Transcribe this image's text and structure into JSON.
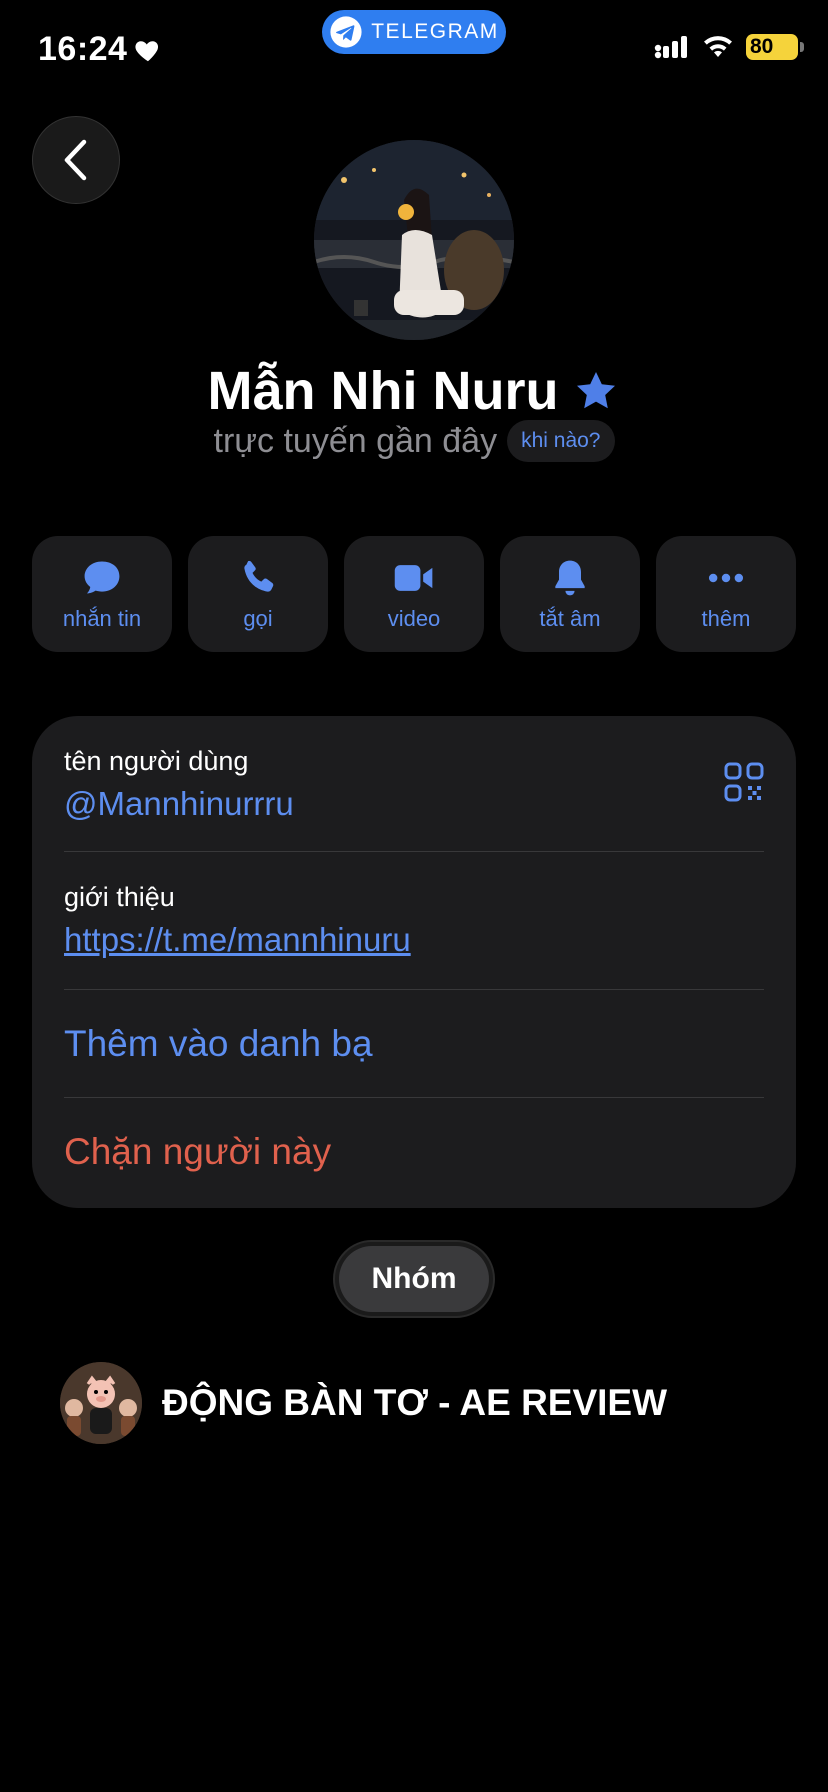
{
  "status_bar": {
    "time": "16:24",
    "heart_icon": "heart-icon",
    "app_pill": "TELEGRAM",
    "battery": "80",
    "signal_icon": "signal-icon",
    "wifi_icon": "wifi-icon"
  },
  "profile": {
    "name": "Mẫn Nhi Nuru",
    "verified_icon": "star-badge-icon",
    "status": "trực tuyến gần đây",
    "when_button": "khi nào?"
  },
  "actions": [
    {
      "label": "nhắn tin",
      "icon": "message-icon"
    },
    {
      "label": "gọi",
      "icon": "phone-icon"
    },
    {
      "label": "video",
      "icon": "video-icon"
    },
    {
      "label": "tắt âm",
      "icon": "bell-icon"
    },
    {
      "label": "thêm",
      "icon": "more-icon"
    }
  ],
  "info": {
    "username_label": "tên người dùng",
    "username_value": "@Mannhinurrru",
    "bio_label": "giới thiệu",
    "bio_value": "https://t.me/mannhinuru",
    "add_contact": "Thêm vào danh bạ",
    "block_user": "Chặn người này"
  },
  "tabs": {
    "group_tab": "Nhóm"
  },
  "groups": [
    {
      "name": "ĐỘNG BÀN TƠ - AE REVIEW"
    }
  ],
  "colors": {
    "accent": "#5d8ef0",
    "danger": "#e0614d",
    "card": "#1c1c1e",
    "telegram": "#2f7ef0",
    "battery": "#f5d33b"
  }
}
